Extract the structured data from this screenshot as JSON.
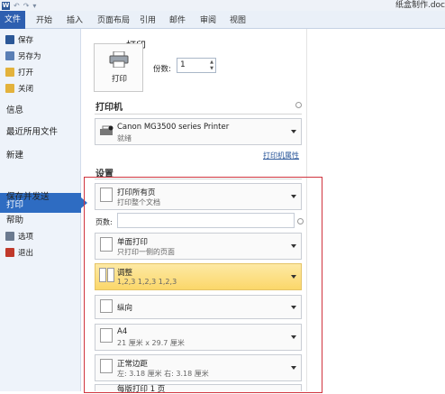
{
  "window": {
    "title": "纸盒制作.doc",
    "qat": [
      "W",
      "↶",
      "↷",
      "▾"
    ]
  },
  "ribbon": {
    "tabs": [
      "文件",
      "开始",
      "插入",
      "页面布局",
      "引用",
      "邮件",
      "审阅",
      "视图"
    ]
  },
  "menu": {
    "small_items": [
      {
        "label": "保存",
        "icon": "save-icon",
        "color": "#2b5797"
      },
      {
        "label": "另存为",
        "icon": "save-as-icon",
        "color": "#5a7fb5"
      },
      {
        "label": "打开",
        "icon": "open-folder-icon",
        "color": "#e3b23c"
      },
      {
        "label": "关闭",
        "icon": "close-folder-icon",
        "color": "#e3b23c"
      }
    ],
    "big_items": [
      "信息",
      "最近所用文件",
      "新建",
      "打印",
      "保存并发送",
      "帮助"
    ],
    "bottom_items": [
      {
        "label": "选项",
        "icon": "options-icon",
        "color": "#6b7a8f"
      },
      {
        "label": "退出",
        "icon": "exit-icon",
        "color": "#c0392b"
      }
    ],
    "selected": "打印",
    "accent": "#2e6cc2"
  },
  "print": {
    "heading": "打印",
    "button_label": "打印",
    "copies_label": "份数:",
    "copies_value": "1"
  },
  "printer": {
    "section": "打印机",
    "name": "Canon MG3500 series Printer",
    "status": "就绪",
    "properties_link": "打印机属性"
  },
  "settings": {
    "section": "设置",
    "pages_label": "页数:",
    "pages_value": "",
    "dropdowns": [
      {
        "main": "打印所有页",
        "sub": "打印整个文档"
      },
      {
        "main": "单面打印",
        "sub": "只打印一侧的页面"
      },
      {
        "main": "调整",
        "sub": "1,2,3    1,2,3    1,2,3"
      },
      {
        "main": "纵向",
        "sub": ""
      },
      {
        "main": "A4",
        "sub": "21 厘米 x 29.7 厘米"
      },
      {
        "main": "正常边距",
        "sub": "左:  3.18 厘米    右:  3.18 厘米"
      },
      {
        "main": "每版打印 1 页",
        "sub": ""
      }
    ]
  },
  "colors": {
    "file_tab": "#2e5fb0",
    "highlight_yellow": "#fbd76a",
    "annotation_red": "#d0343e"
  }
}
